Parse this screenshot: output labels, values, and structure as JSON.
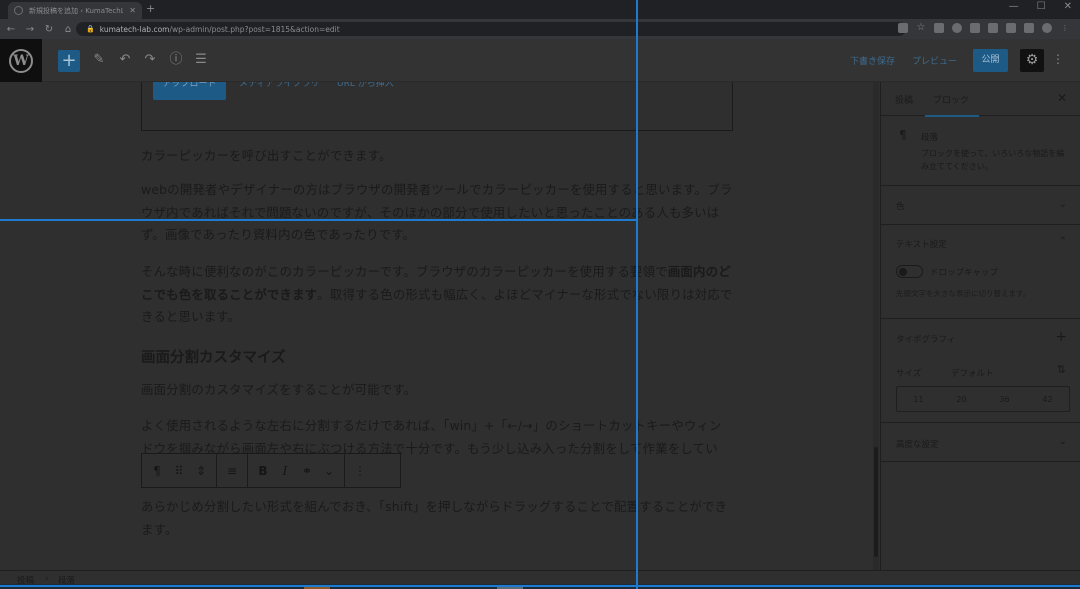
{
  "browser": {
    "tab_title": "新規投稿を追加 ‹ KumaTechLab —",
    "url_host": "kumatech-lab.com",
    "url_path": "/wp-admin/post.php?post=1815&action=edit",
    "new_tab": "+",
    "win_min": "—",
    "win_max": "☐",
    "win_close": "✕"
  },
  "toolbar": {
    "draft_label": "下書き保存",
    "preview_label": "プレビュー",
    "publish_label": "公開"
  },
  "file_block": {
    "upload_label": "アップロード",
    "media_label": "メディアライブラリ",
    "url_label": "URL から挿入"
  },
  "content": {
    "p1": "カラーピッカーを呼び出すことができます。",
    "p2": "webの開発者やデザイナーの方はブラウザの開発者ツールでカラーピッカーを使用すると思います。ブラウザ内であればそれで問題ないのですが、そのほかの部分で使用したいと思ったことのある人も多いはず。画像であったり資料内の色であったりです。",
    "p3_a": "そんな時に便利なのがこのカラーピッカーです。ブラウザのカラーピッカーを使用する要領で",
    "p3_bold": "画面内のどこでも色を取ることができます",
    "p3_b": "。取得する色の形式も幅広く、よほどマイナーな形式でない限りは対応できると思います。",
    "h2": "画面分割カスタマイズ",
    "p4": "画面分割のカスタマイズをすることが可能です。",
    "p5": "よく使用されるような左右に分割するだけであれば、「win」+「←/→」のショートカットキーやウィンドウを掴みながら画面左や右にぶつける方法で十分です。もう少し込み入った分割をして作業をしてい",
    "p6": "あらかじめ分割したい形式を組んでおき、「shift」を押しながらドラッグすることで配置することができます。"
  },
  "sidebar": {
    "tab_post": "投稿",
    "tab_block": "ブロック",
    "block_name": "段落",
    "block_desc": "ブロックを使って、いろいろな物語を編み立ててください。",
    "color_label": "色",
    "text_settings_label": "テキスト設定",
    "dropcap_label": "ドロップキャップ",
    "dropcap_help": "先頭文字を大きな表示に切り替えます。",
    "typography_label": "タイポグラフィ",
    "size_label": "サイズ",
    "size_value": "デフォルト",
    "size_options": [
      "11",
      "20",
      "36",
      "42"
    ],
    "advanced_label": "高度な設定"
  },
  "breadcrumb": {
    "item1": "投稿",
    "sep": "›",
    "item2": "段落"
  }
}
